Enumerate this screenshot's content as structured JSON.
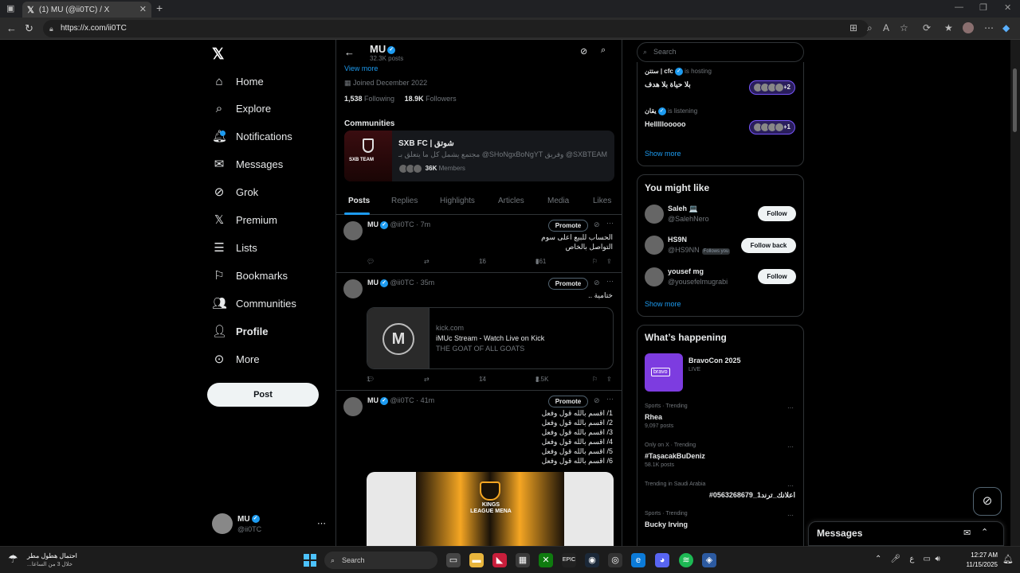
{
  "browser": {
    "tab_title": "(1) MU (@ii0TC) / X",
    "url": "https://x.com/ii0TC"
  },
  "leftnav": {
    "items": [
      {
        "label": "Home",
        "icon": "home-icon"
      },
      {
        "label": "Explore",
        "icon": "search-icon"
      },
      {
        "label": "Notifications",
        "icon": "bell-icon"
      },
      {
        "label": "Messages",
        "icon": "mail-icon"
      },
      {
        "label": "Grok",
        "icon": "grok-icon"
      },
      {
        "label": "Premium",
        "icon": "x-icon"
      },
      {
        "label": "Lists",
        "icon": "list-icon"
      },
      {
        "label": "Bookmarks",
        "icon": "bookmark-icon"
      },
      {
        "label": "Communities",
        "icon": "people-icon"
      },
      {
        "label": "Profile",
        "icon": "person-icon"
      },
      {
        "label": "More",
        "icon": "more-circle-icon"
      }
    ],
    "post_label": "Post",
    "me": {
      "name": "MU",
      "handle": "@ii0TC"
    }
  },
  "profile": {
    "name": "MU",
    "post_count": "32.3K posts",
    "view_more": "View more",
    "joined": "Joined December 2022",
    "following_count": "1,538",
    "following_label": "Following",
    "followers_count": "18.9K",
    "followers_label": "Followers",
    "communities_heading": "Communities",
    "community": {
      "name": "SXB FC | شوتق",
      "description": "مجتمع يشمل كل ما يتعلق بـ @SHoNgxBoNgYT وفريق @SXBTEAM",
      "members_count": "36K",
      "members_label": "Members",
      "image_text": "SXB TEAM"
    },
    "tabs": [
      "Posts",
      "Replies",
      "Highlights",
      "Articles",
      "Media",
      "Likes"
    ]
  },
  "posts": [
    {
      "name": "MU",
      "handle": "@ii0TC",
      "time": "7m",
      "promote": "Promote",
      "text_lines": [
        "الحساب للبيع اعلى سوم",
        "التواصل بالخاص"
      ],
      "replies": "",
      "likes": "16",
      "views": "861"
    },
    {
      "name": "MU",
      "handle": "@ii0TC",
      "time": "35m",
      "promote": "Promote",
      "text_lines": [
        "ختامية .."
      ],
      "card": {
        "domain": "kick.com",
        "title": "iMUc Stream - Watch Live on Kick",
        "subtitle": "THE GOAT OF ALL GOATS"
      },
      "replies": "1",
      "likes": "14",
      "views": "2.5K"
    },
    {
      "name": "MU",
      "handle": "@ii0TC",
      "time": "41m",
      "promote": "Promote",
      "text_lines": [
        "1/ اقسم بالله قول وفعل",
        "2/ اقسم بالله قول وفعل",
        "3/ اقسم بالله قول وفعل",
        "4/ اقسم بالله قول وفعل",
        "5/ اقسم بالله قول وفعل",
        "6/ اقسم بالله قول وفعل"
      ],
      "media_text": "KINGS LEAGUE MENA"
    }
  ],
  "right": {
    "search_placeholder": "Search",
    "spaces": [
      {
        "host": "ستتن | cfc",
        "status": "is hosting",
        "title": "بلا حياة بلا هدف",
        "extra": "+2"
      },
      {
        "host": "يقان",
        "status": "is listening",
        "title": "Helllllooooo",
        "extra": "+1"
      }
    ],
    "spaces_show_more": "Show more",
    "wtf_heading": "You might like",
    "wtf": [
      {
        "name": "Saleh 💻",
        "handle": "@SalehNero",
        "button": "Follow",
        "follows_you": ""
      },
      {
        "name": "HS9N",
        "handle": "@HS9NN",
        "button": "Follow back",
        "follows_you": "Follows you"
      },
      {
        "name": "yousef mg",
        "handle": "@yousefelmugrabi",
        "button": "Follow",
        "follows_you": ""
      }
    ],
    "wtf_show_more": "Show more",
    "happening_heading": "What’s happening",
    "event": {
      "title": "BravoCon 2025",
      "status": "LIVE",
      "thumb_text": "bravo"
    },
    "trends": [
      {
        "meta": "Sports · Trending",
        "name": "Rhea",
        "posts": "9,097 posts"
      },
      {
        "meta": "Only on X · Trending",
        "name": "#TaşacakBuDeniz",
        "posts": "58.1K posts"
      },
      {
        "meta": "Trending in Saudi Arabia",
        "name": "#اعلانك_ترند1_0563268679",
        "posts": ""
      },
      {
        "meta": "Sports · Trending",
        "name": "Bucky Irving",
        "posts": ""
      }
    ]
  },
  "dock": {
    "messages_label": "Messages"
  },
  "taskbar": {
    "weather_line1": "احتمال هطول مطر",
    "weather_line2": "خلال 3 من الساعا...",
    "search_label": "Search",
    "lang": "ع",
    "time": "12:27 AM",
    "date": "11/15/2025"
  },
  "colors": {
    "accent": "#1d9bf0",
    "bg": "#000000",
    "border": "#2f3336",
    "muted": "#71767b"
  }
}
